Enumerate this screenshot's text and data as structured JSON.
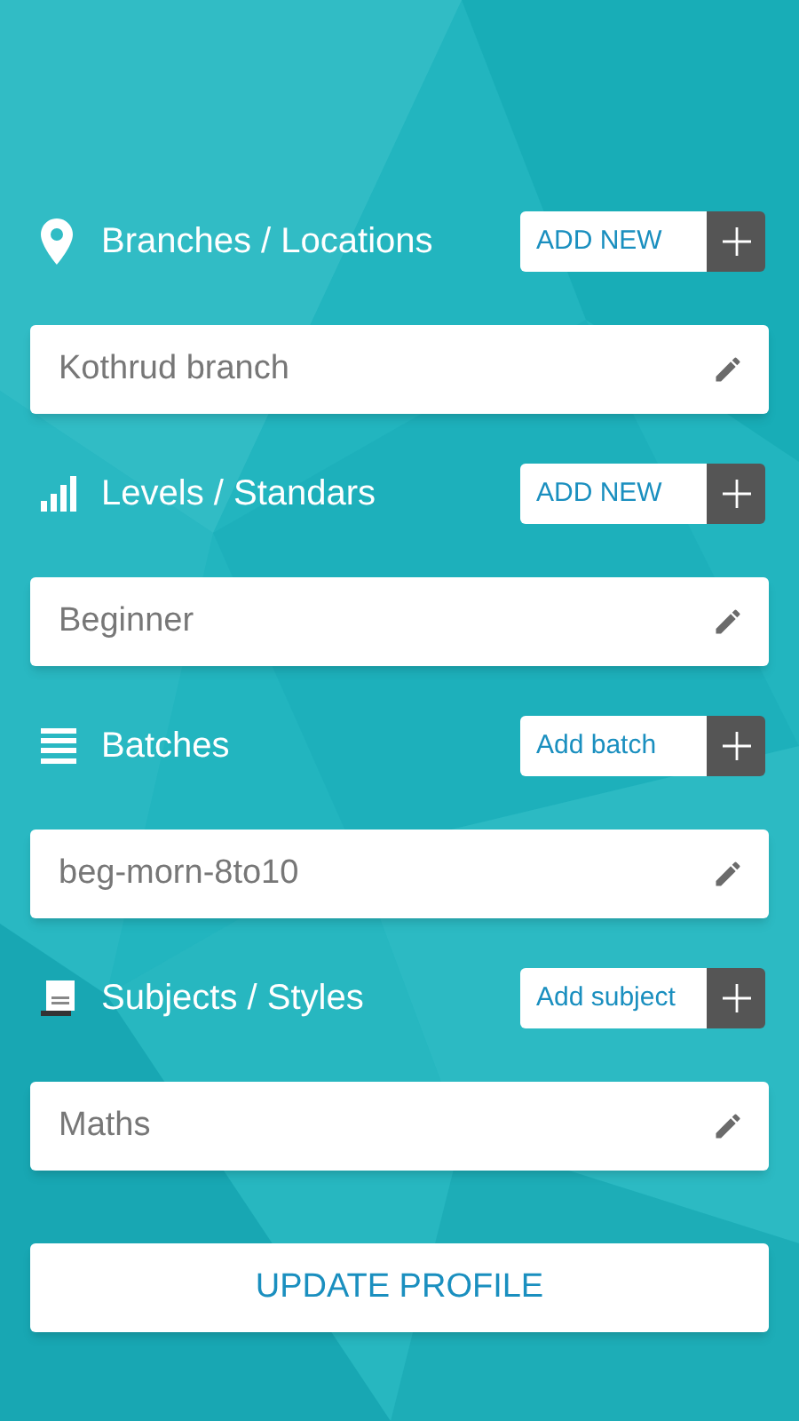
{
  "sections": [
    {
      "kind": "location",
      "title": "Branches / Locations",
      "add_button": "ADD NEW",
      "value": "Kothrud branch"
    },
    {
      "kind": "levels",
      "title": "Levels / Standars",
      "add_button": "ADD NEW",
      "value": "Beginner"
    },
    {
      "kind": "list",
      "title": "Batches",
      "add_button": "Add batch",
      "value": "beg-morn-8to10"
    },
    {
      "kind": "book",
      "title": "Subjects / Styles",
      "add_button": "Add subject",
      "value": "Maths"
    }
  ],
  "update_button": "UPDATE PROFILE"
}
